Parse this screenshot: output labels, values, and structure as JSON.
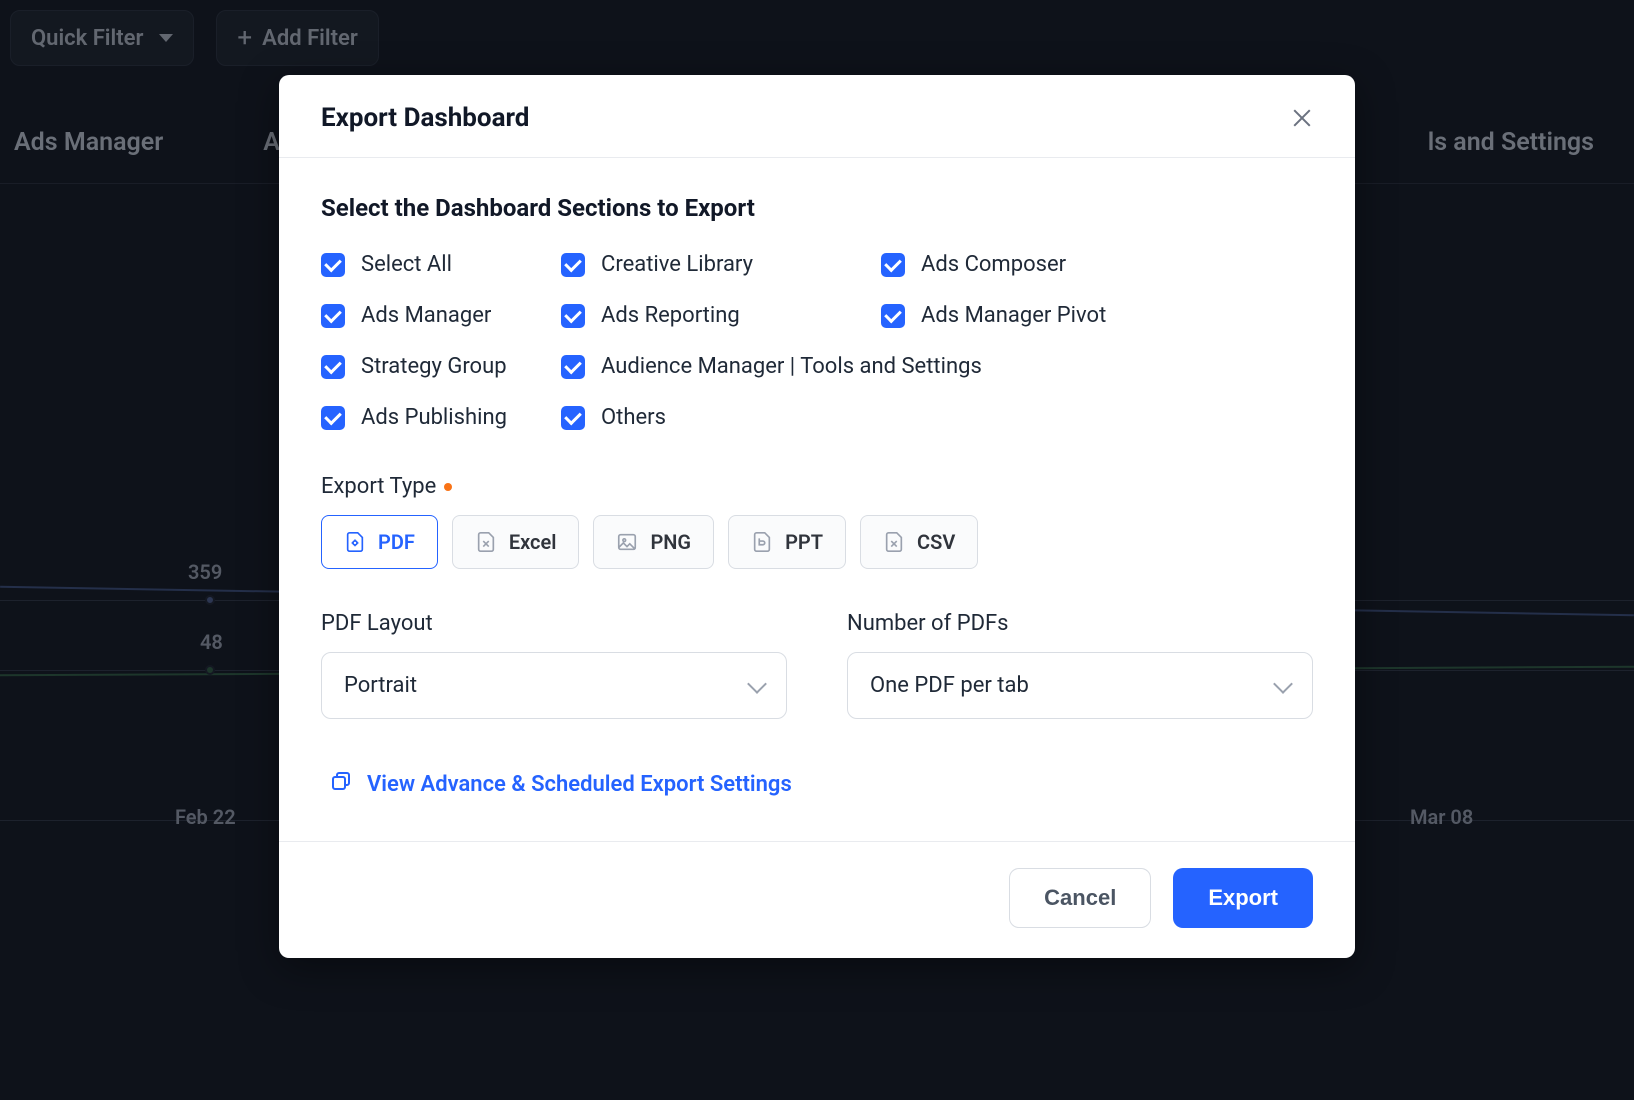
{
  "background": {
    "quick_filter": "Quick Filter",
    "add_filter": "Add Filter",
    "tabs": [
      "Ads Manager",
      "A",
      "ls and Settings"
    ],
    "chart_labels": {
      "v1": "359",
      "v2": "48",
      "d1": "Feb 22",
      "d2": "Mar 08"
    }
  },
  "modal": {
    "title": "Export Dashboard",
    "section_heading": "Select the Dashboard Sections to Export",
    "checkboxes": {
      "select_all": "Select All",
      "creative_library": "Creative Library",
      "ads_composer": "Ads Composer",
      "ads_manager": "Ads Manager",
      "ads_reporting": "Ads Reporting",
      "ads_manager_pivot": "Ads Manager Pivot",
      "strategy_group": "Strategy Group",
      "audience_tools": "Audience Manager | Tools and Settings",
      "ads_publishing": "Ads Publishing",
      "others": "Others"
    },
    "export_type_label": "Export Type",
    "types": {
      "pdf": "PDF",
      "excel": "Excel",
      "png": "PNG",
      "ppt": "PPT",
      "csv": "CSV"
    },
    "pdf_layout_label": "PDF Layout",
    "pdf_layout_value": "Portrait",
    "num_pdfs_label": "Number of PDFs",
    "num_pdfs_value": "One PDF per tab",
    "advanced_link": "View Advance & Scheduled Export Settings",
    "cancel": "Cancel",
    "export": "Export"
  }
}
